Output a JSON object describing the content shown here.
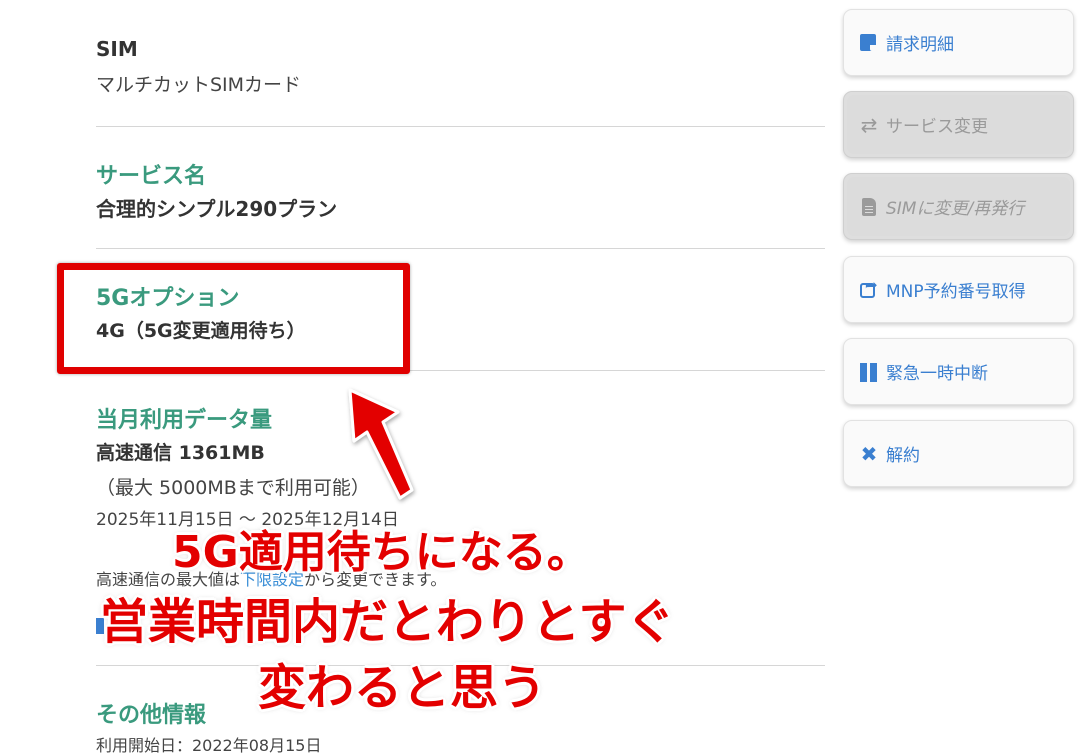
{
  "main": {
    "sim_label": "SIM",
    "sim_value": "マルチカットSIMカード",
    "service_label": "サービス名",
    "service_value": "合理的シンプル290プラン",
    "option_label": "5Gオプション",
    "option_value": "4G（5G変更適用待ち）",
    "usage_label": "当月利用データ量",
    "usage_value": "高速通信 1361MB",
    "usage_max": "（最大 5000MBまで利用可能）",
    "usage_period": "2025年11月15日 ～ 2025年12月14日",
    "limit_note_pre": "高速通信の最大値は",
    "limit_note_link": "下限設定",
    "limit_note_post": "から変更できます。",
    "other_label": "その他情報",
    "start_date": "利用開始日：2022年08月15日"
  },
  "sidebar": {
    "items": [
      {
        "label": "請求明細",
        "icon": "bill-icon",
        "disabled": false
      },
      {
        "label": "サービス変更",
        "icon": "swap-icon",
        "disabled": true
      },
      {
        "label": "SIMに変更/再発行",
        "icon": "sim-card-icon",
        "disabled": true
      },
      {
        "label": "MNP予約番号取得",
        "icon": "share-icon",
        "disabled": false
      },
      {
        "label": "緊急一時中断",
        "icon": "pause-icon",
        "disabled": false
      },
      {
        "label": "解約",
        "icon": "close-icon",
        "disabled": false
      }
    ]
  },
  "annotation": {
    "line1": "5G適用待ちになる。",
    "line2": "営業時間内だとわりとすぐ",
    "line3": "変わると思う",
    "color": "#e30000"
  },
  "colors": {
    "section_label": "#3a9a7e",
    "link": "#3a8ed6",
    "sidebar_link": "#3a7fd0",
    "annotation_red": "#e00000"
  }
}
